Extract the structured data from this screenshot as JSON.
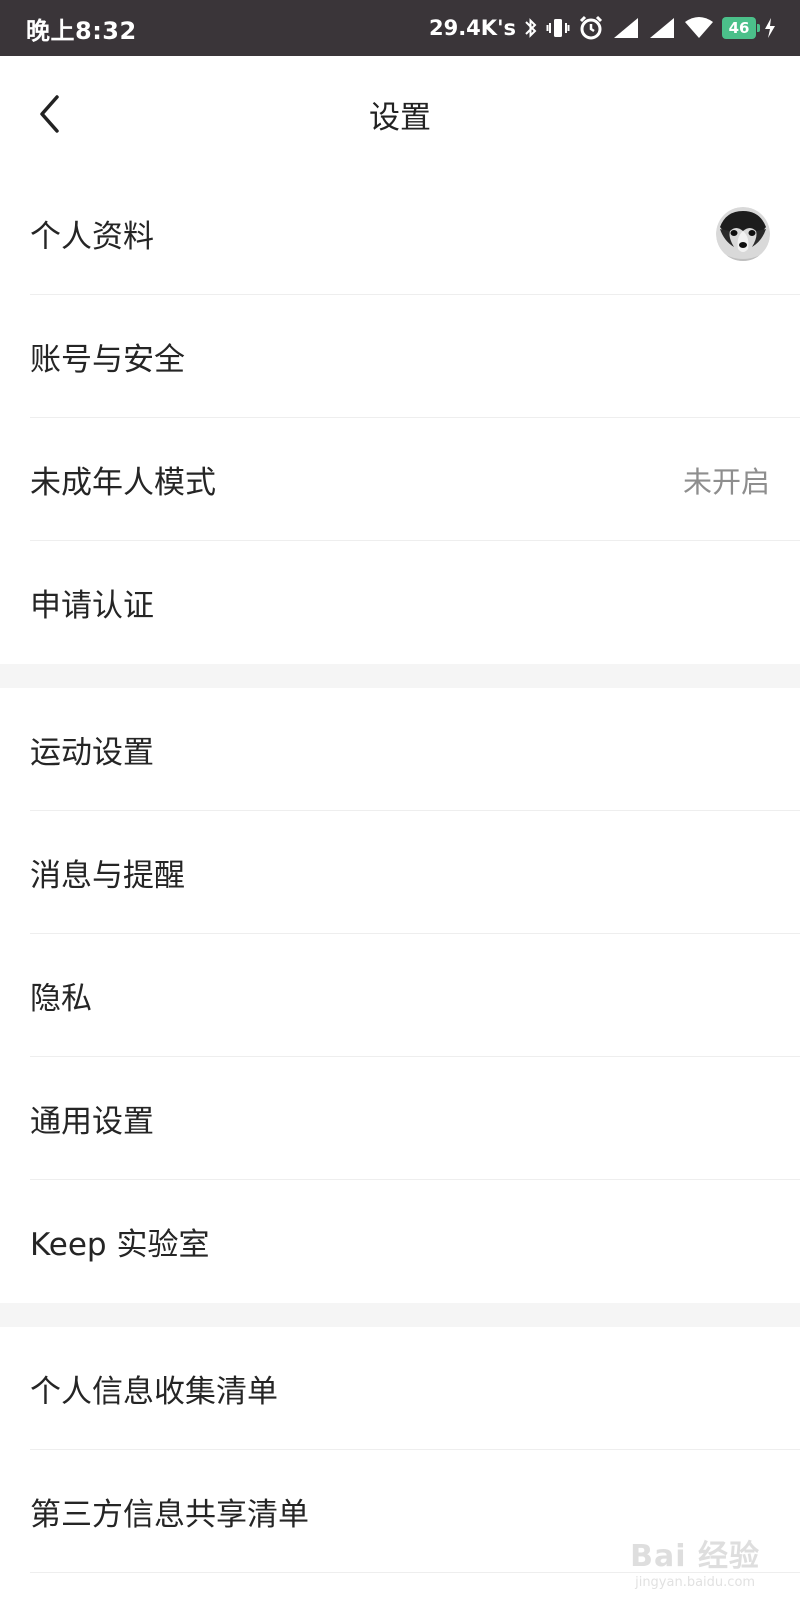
{
  "status_bar": {
    "time": "晚上8:32",
    "speed": "29.4K's",
    "battery": "46",
    "icons": [
      "bluetooth-icon",
      "vibrate-icon",
      "alarm-icon",
      "signal-icon",
      "signal-icon",
      "wifi-icon",
      "battery-icon",
      "charging-icon"
    ]
  },
  "nav": {
    "title": "设置",
    "back_icon": "chevron-left-icon"
  },
  "groups": [
    {
      "items": [
        {
          "label": "个人资料",
          "trailing": "avatar"
        },
        {
          "label": "账号与安全"
        },
        {
          "label": "未成年人模式",
          "value": "未开启"
        },
        {
          "label": "申请认证"
        }
      ]
    },
    {
      "items": [
        {
          "label": "运动设置"
        },
        {
          "label": "消息与提醒"
        },
        {
          "label": "隐私"
        },
        {
          "label": "通用设置"
        },
        {
          "label": "Keep 实验室"
        }
      ]
    },
    {
      "items": [
        {
          "label": "个人信息收集清单"
        },
        {
          "label": "第三方信息共享清单"
        }
      ]
    }
  ],
  "watermark": {
    "logo": "Bai 经验",
    "sub": "jingyan.baidu.com"
  },
  "colors": {
    "status_bar_bg": "#3a3539",
    "battery": "#4bc08a",
    "section_gap": "#f5f5f5",
    "divider": "#eeeeee",
    "secondary_text": "#8e8e8e"
  }
}
